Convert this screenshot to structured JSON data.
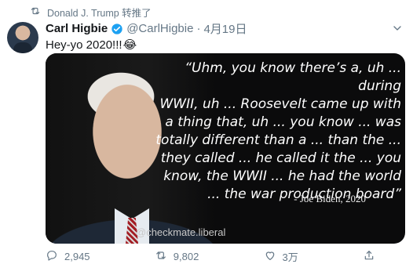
{
  "retweet_context": {
    "text": "Donald J. Trump 转推了"
  },
  "tweet": {
    "display_name": "Carl Higbie",
    "handle": "@CarlHigbie",
    "separator": "·",
    "date": "4月19日",
    "text": "Hey-yo 2020!!!",
    "emoji": "😂",
    "media": {
      "quote_lines": [
        "“Uhm, you know there’s a, uh ... during",
        "WWII, uh ... Roosevelt came up with",
        "a thing that, uh ... you know ... was",
        "totally different than a ... than the ...",
        "they called ... he called it the ... you",
        "know, the WWII ... he had the world",
        "... the war production board”"
      ],
      "attribution": "- Joe Biden, 2020",
      "watermark": "@checkmate.liberal"
    },
    "actions": {
      "replies": "2,945",
      "retweets": "9,802",
      "likes": "3万"
    }
  },
  "colors": {
    "verified_blue": "#1da1f2",
    "meta_gray": "#657786"
  }
}
